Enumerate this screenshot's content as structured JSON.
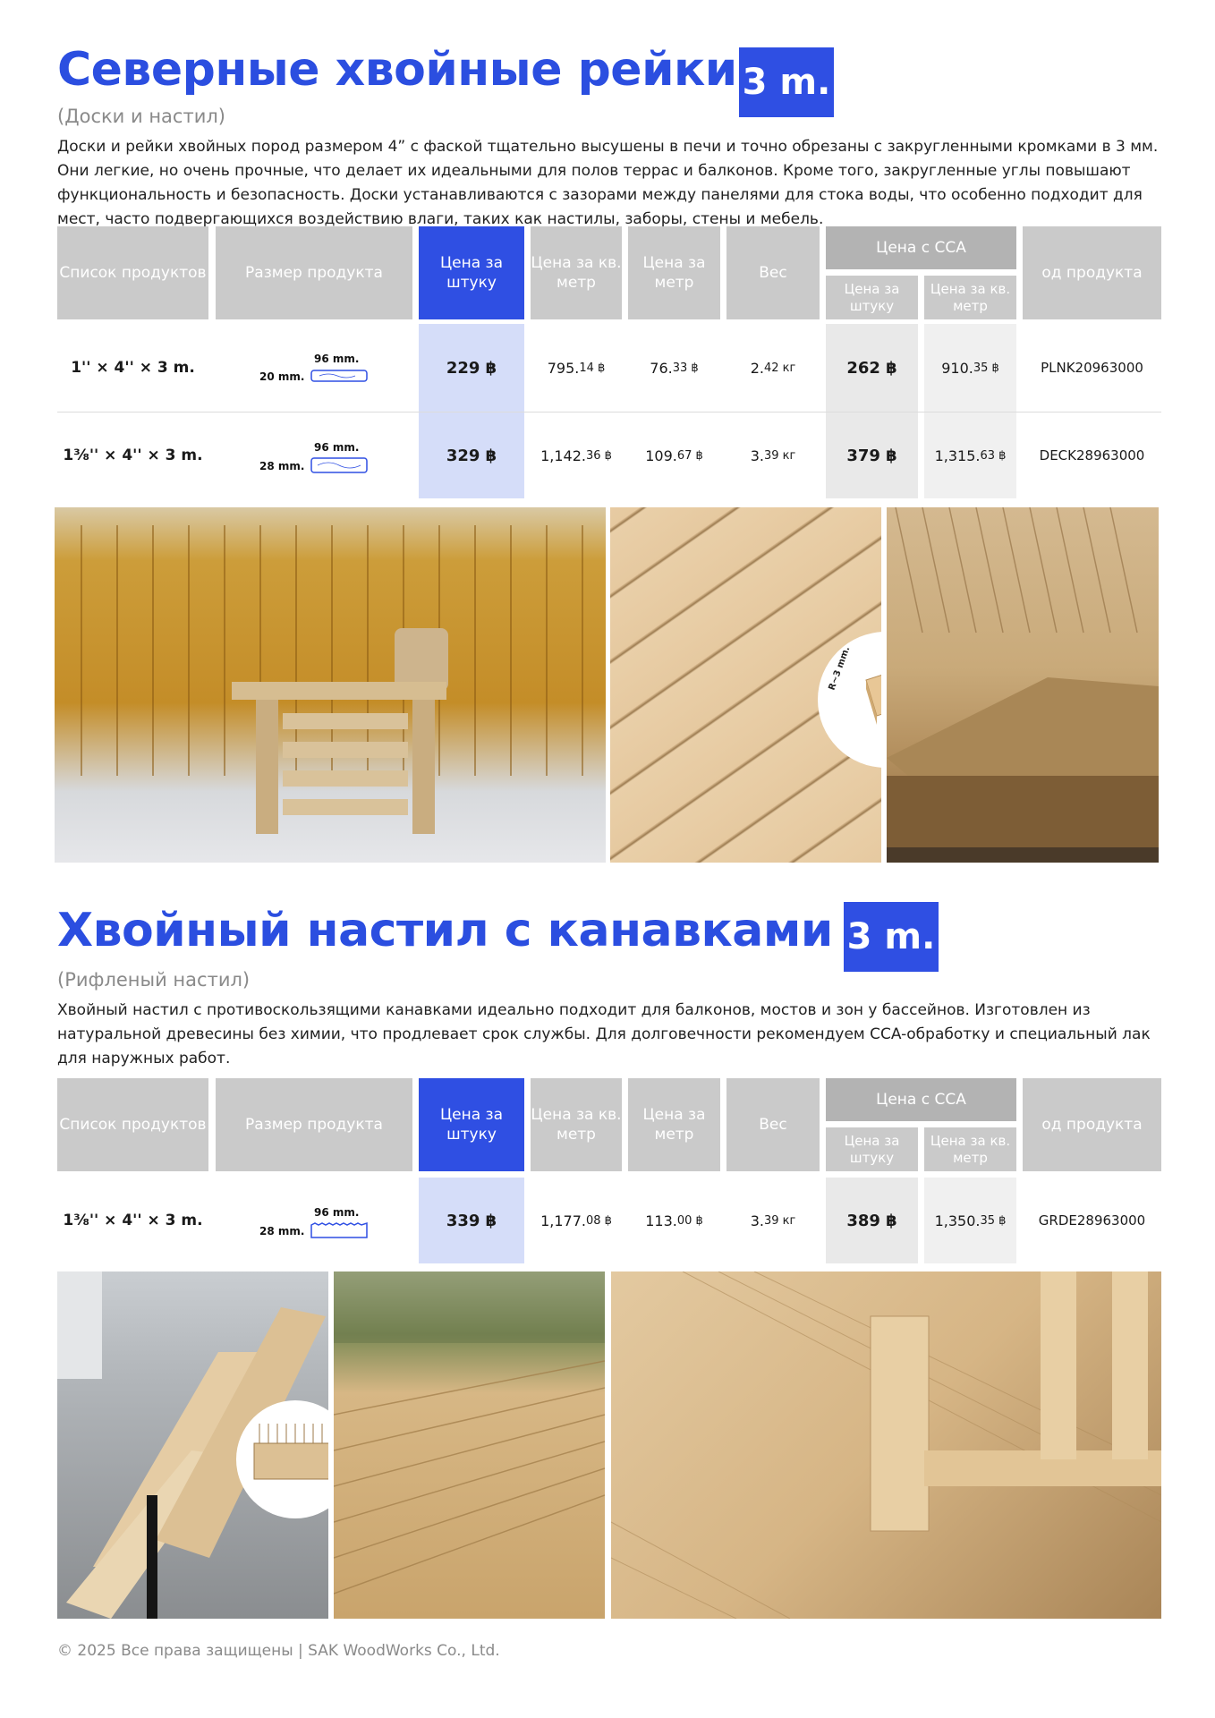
{
  "section1": {
    "title": "Северные хвойные рейки",
    "badge": "3 m.",
    "subtitle": "(Доски и настил)",
    "description": "Доски и рейки хвойных пород размером 4” с фаской тщательно высушены в печи и точно обрезаны с закругленными кромками в 3 мм. Они легкие, но очень прочные, что делает их идеальными для полов террас и балконов. Кроме того, закругленные углы повышают функциональность и безопасность. Доски устанавливаются с зазорами между панелями для стока воды, что особенно подходит для мест, часто подвергающихся воздействию влаги, таких как настилы, заборы, стены и мебель.",
    "rows": [
      {
        "name": "1'' × 4'' × 3 m.",
        "dim_w": "96 mm.",
        "dim_h": "20 mm.",
        "price": "229 ฿",
        "sqm_main": "795.",
        "sqm_frac": "14 ฿",
        "m_main": "76.",
        "m_frac": "33 ฿",
        "w_main": "2.",
        "w_frac": "42 кг",
        "cca_price": "262 ฿",
        "cca_sqm_main": "910.",
        "cca_sqm_frac": "35 ฿",
        "code": "PLNK20963000"
      },
      {
        "name": "1⅜'' × 4'' × 3 m.",
        "dim_w": "96 mm.",
        "dim_h": "28 mm.",
        "price": "329 ฿",
        "sqm_main": "1,142.",
        "sqm_frac": "36 ฿",
        "m_main": "109.",
        "m_frac": "67 ฿",
        "w_main": "3.",
        "w_frac": "39 кг",
        "cca_price": "379 ฿",
        "cca_sqm_main": "1,315.",
        "cca_sqm_frac": "63 ฿",
        "code": "DECK28963000"
      }
    ],
    "radius_label": "R~3 mm."
  },
  "section2": {
    "title": "Хвойный настил с канавками",
    "badge": "3 m.",
    "subtitle": "(Рифленый настил)",
    "description": "Хвойный настил с противоскользящими канавками идеально подходит для балконов, мостов и зон у бассейнов. Изготовлен из натуральной древесины без химии, что продлевает срок службы. Для долговечности рекомендуем CCA-обработку и специальный лак для наружных работ.",
    "rows": [
      {
        "name": "1⅜'' × 4'' × 3 m.",
        "dim_w": "96 mm.",
        "dim_h": "28 mm.",
        "price": "339 ฿",
        "sqm_main": "1,177.",
        "sqm_frac": "08 ฿",
        "m_main": "113.",
        "m_frac": "00 ฿",
        "w_main": "3.",
        "w_frac": "39 кг",
        "cca_price": "389 ฿",
        "cca_sqm_main": "1,350.",
        "cca_sqm_frac": "35 ฿",
        "code": "GRDE28963000"
      }
    ]
  },
  "headers": {
    "list": "Список продуктов",
    "size": "Размер продукта",
    "price_unit": "Цена за штуку",
    "price_sqm": "Цена за кв. метр",
    "price_m": "Цена за метр",
    "weight": "Вес",
    "cca": "Цена с CCA",
    "cca_unit": "Цена за штуку",
    "cca_sqm": "Цена за кв. метр",
    "code": "од продукта"
  },
  "footer": "© 2025 Все права защищены | SAK WoodWorks Co., Ltd.",
  "colors": {
    "accent": "#2f4fe3",
    "header_gray": "#cacaca",
    "wood": "#d8b987"
  }
}
